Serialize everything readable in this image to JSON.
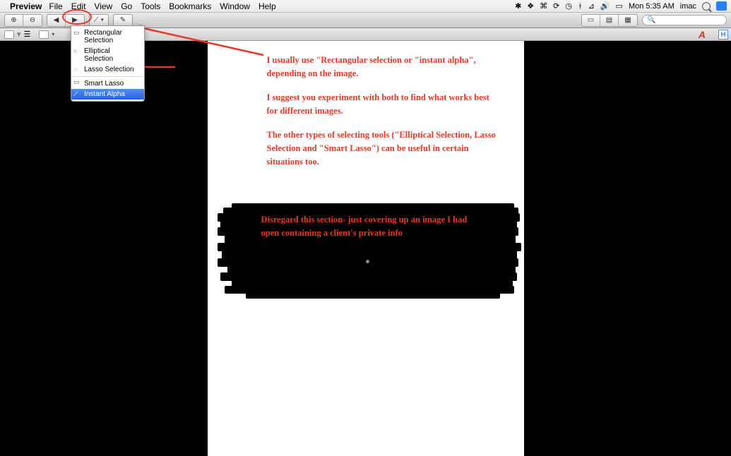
{
  "menubar": {
    "app_name": "Preview",
    "items": [
      "File",
      "Edit",
      "View",
      "Go",
      "Tools",
      "Bookmarks",
      "Window",
      "Help"
    ],
    "clock": "Mon 5:35 AM",
    "user": "imac"
  },
  "toolbar": {
    "search_placeholder": ""
  },
  "dropdown": {
    "items": [
      {
        "label": "Rectangular Selection",
        "icon": "▭"
      },
      {
        "label": "Elliptical Selection",
        "icon": "◯"
      },
      {
        "label": "Lasso Selection",
        "icon": "◌"
      },
      {
        "label": "Smart Lasso",
        "icon": "▭",
        "sep": true
      },
      {
        "label": "Instant Alpha",
        "icon": "✦",
        "highlight": true
      }
    ]
  },
  "page": {
    "para1": "I usually use \"Rectangular selection or \"instant alpha\", depending on the image.",
    "para2": "I suggest you experiment with both to find what works best for different images.",
    "para3": "The other types of selecting tools (\"Elliptical Selection, Lasso Selection and \"Smart Lasso\") can be useful in certain situations too.",
    "redact_text": "Disregard this section- just covering up an image I had open containing a client's private info"
  }
}
